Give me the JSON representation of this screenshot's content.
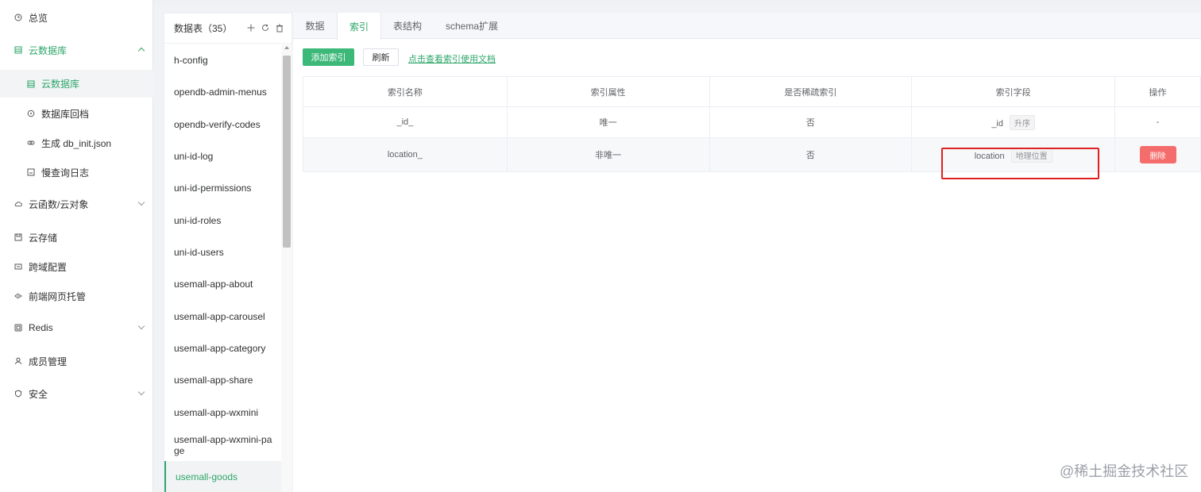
{
  "nav": {
    "overview": "总览",
    "clouddb_group": "云数据库",
    "clouddb_item": "云数据库",
    "db_backup": "数据库回档",
    "gen_init": "生成 db_init.json",
    "slow_log": "慢查询日志",
    "functions": "云函数/云对象",
    "storage": "云存储",
    "cors": "跨域配置",
    "hosting": "前端网页托管",
    "redis": "Redis",
    "members": "成员管理",
    "security": "安全"
  },
  "collections": {
    "header": "数据表（35）",
    "items": [
      "h-config",
      "opendb-admin-menus",
      "opendb-verify-codes",
      "uni-id-log",
      "uni-id-permissions",
      "uni-id-roles",
      "uni-id-users",
      "usemall-app-about",
      "usemall-app-carousel",
      "usemall-app-category",
      "usemall-app-share",
      "usemall-app-wxmini",
      "usemall-app-wxmini-page",
      "usemall-goods"
    ]
  },
  "tabs": [
    "数据",
    "索引",
    "表结构",
    "schema扩展"
  ],
  "toolbar": {
    "add_index": "添加索引",
    "refresh": "刷新",
    "doc_link": "点击查看索引使用文档"
  },
  "table": {
    "headers": [
      "索引名称",
      "索引属性",
      "是否稀疏索引",
      "索引字段",
      "操作"
    ],
    "rows": [
      {
        "name": "_id_",
        "attr": "唯一",
        "sparse": "否",
        "field": "_id",
        "field_tag": "升序",
        "action": "-"
      },
      {
        "name": "location_",
        "attr": "非唯一",
        "sparse": "否",
        "field": "location",
        "field_tag": "地理位置",
        "action": "删除"
      }
    ]
  },
  "watermark": "@稀土掘金技术社区",
  "colors": {
    "accent": "#2ea76a",
    "primary_button": "#3cb879",
    "danger": "#f56c6c",
    "highlight_box": "#e02020"
  }
}
